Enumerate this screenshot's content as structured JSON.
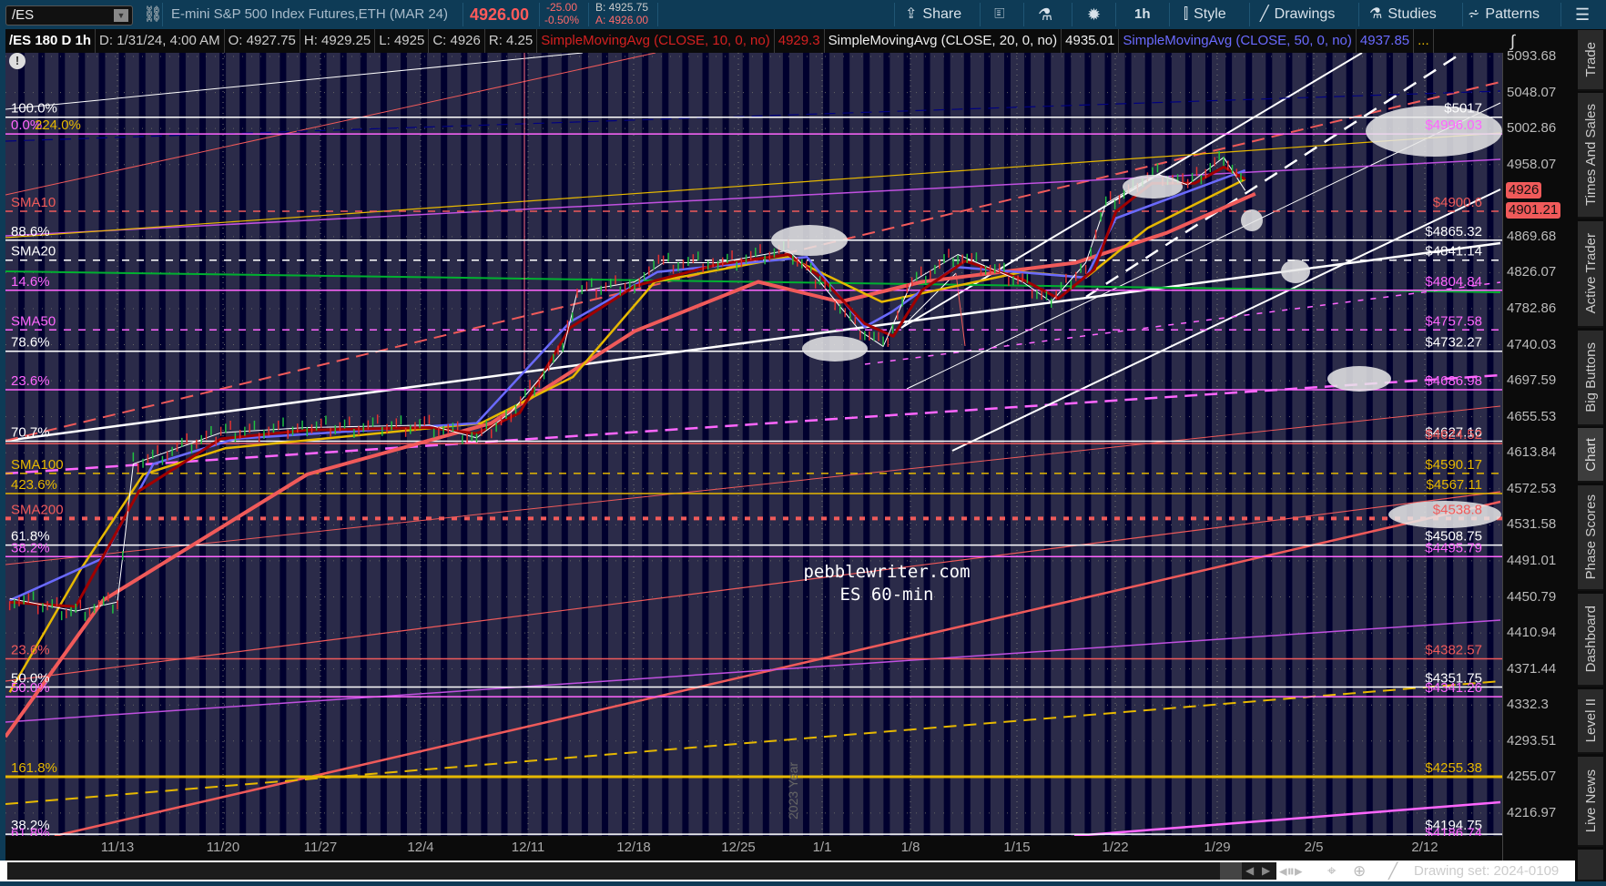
{
  "toolbar": {
    "symbol": "/ES",
    "title": "E-mini S&P 500 Index Futures,ETH (MAR 24)",
    "last_price": "4926.00",
    "change": "-25.00",
    "change_pct": "-0.50%",
    "bid": "B: 4925.75",
    "ask": "A: 4926.00",
    "buttons": {
      "share": "Share",
      "timeframe": "1h",
      "style": "Style",
      "drawings": "Drawings",
      "studies": "Studies",
      "patterns": "Patterns"
    }
  },
  "info": {
    "chart_id": "/ES 180 D 1h",
    "date": "D: 1/31/24, 4:00 AM",
    "open": "O: 4927.75",
    "high": "H: 4929.25",
    "low": "L: 4925",
    "close": "C: 4926",
    "range": "R: 4.25",
    "sma10_label": "SimpleMovingAvg (CLOSE, 10, 0, no)",
    "sma10_value": "4929.3",
    "sma20_label": "SimpleMovingAvg (CLOSE, 20, 0, no)",
    "sma20_value": "4935.01",
    "sma50_label": "SimpleMovingAvg (CLOSE, 50, 0, no)",
    "sma50_value": "4937.85",
    "more": "..."
  },
  "colors": {
    "bg": "#2b2b49",
    "stripe": "#00002e",
    "red": "#f05a5a",
    "magenta": "#ff66ff",
    "yellow": "#e6b800",
    "white": "#ffffff",
    "green": "#00b030",
    "blue": "#6a6aff",
    "darkred": "#a00000"
  },
  "price_axis": {
    "ticks": [
      "5093.68",
      "5048.07",
      "5002.86",
      "4958.07",
      "4869.68",
      "4826.07",
      "4782.86",
      "4740.03",
      "4697.59",
      "4655.53",
      "4613.84",
      "4572.53",
      "4531.58",
      "4491.01",
      "4450.79",
      "4410.94",
      "4371.44",
      "4332.3",
      "4293.51",
      "4255.07",
      "4216.97"
    ],
    "last_badge": "4926",
    "level_badge": "4901.21"
  },
  "date_axis": {
    "labels": [
      "11/13",
      "11/20",
      "11/27",
      "12/4",
      "12/11",
      "12/18",
      "12/25",
      "1/1",
      "1/8",
      "1/15",
      "1/22",
      "1/29",
      "2/5",
      "2/12"
    ],
    "year_marker": "2023 Year"
  },
  "watermark": {
    "line1": "pebblewriter.com",
    "line2": "ES 60-min"
  },
  "levels": [
    {
      "price": 5017,
      "right": "$5017",
      "left": "100.0%",
      "color": "#ffffff",
      "style": "solid"
    },
    {
      "price": 4996.03,
      "right": "$4996.03",
      "left": "0.0%",
      "left2": "224.0%",
      "color": "#ff66ff",
      "style": "solid"
    },
    {
      "price": 4900.6,
      "right": "$4900.6",
      "left": "SMA10",
      "color": "#f05a5a",
      "style": "dash"
    },
    {
      "price": 4865.32,
      "right": "$4865.32",
      "left": "88.6%",
      "color": "#ffffff",
      "style": "solid"
    },
    {
      "price": 4841.14,
      "right": "$4841.14",
      "left": "SMA20",
      "color": "#ffffff",
      "style": "dash"
    },
    {
      "price": 4804.84,
      "right": "$4804.84",
      "left": "14.6%",
      "color": "#ff66ff",
      "style": "solid"
    },
    {
      "price": 4757.58,
      "right": "$4757.58",
      "left": "SMA50",
      "color": "#ff66ff",
      "style": "dash"
    },
    {
      "price": 4732.27,
      "right": "$4732.27",
      "left": "78.6%",
      "color": "#ffffff",
      "style": "solid"
    },
    {
      "price": 4686.98,
      "right": "$4686.98",
      "left": "23.6%",
      "color": "#ff66ff",
      "style": "solid"
    },
    {
      "price": 4627.16,
      "right": "$4627.16",
      "left": "70.7%",
      "color": "#ffffff",
      "style": "solid"
    },
    {
      "price": 4624.52,
      "right": "$4624.52",
      "left": "",
      "color": "#f05a5a",
      "style": "solid"
    },
    {
      "price": 4590.17,
      "right": "$4590.17",
      "left": "SMA100",
      "color": "#e6b800",
      "style": "dash"
    },
    {
      "price": 4567.11,
      "right": "$4567.11",
      "left": "423.6%",
      "color": "#e6b800",
      "style": "solid"
    },
    {
      "price": 4538.8,
      "right": "$4538.8",
      "left": "SMA200",
      "color": "#f05a5a",
      "style": "dot"
    },
    {
      "price": 4508.75,
      "right": "$4508.75",
      "left": "61.8%",
      "color": "#ffffff",
      "style": "solid"
    },
    {
      "price": 4495.79,
      "right": "$4495.79",
      "left": "38.2%",
      "color": "#ff66ff",
      "style": "solid"
    },
    {
      "price": 4382.57,
      "right": "$4382.57",
      "left": "23.6%",
      "color": "#f05a5a",
      "style": "solid"
    },
    {
      "price": 4351.75,
      "right": "$4351.75",
      "left": "50.0%",
      "color": "#ffffff",
      "style": "solid"
    },
    {
      "price": 4341.26,
      "right": "$4341.26",
      "left": "50.0%",
      "color": "#ff66ff",
      "style": "solid"
    },
    {
      "price": 4255.38,
      "right": "$4255.38",
      "left": "161.8%",
      "color": "#e6b800",
      "style": "thick"
    },
    {
      "price": 4194.75,
      "right": "$4194.75",
      "left": "38.2%",
      "color": "#ffffff",
      "style": "solid"
    },
    {
      "price": 4186.74,
      "right": "$4186.74",
      "left": "61.8%",
      "color": "#ff66ff",
      "style": "solid"
    }
  ],
  "chart_data": {
    "type": "line",
    "title": "/ES 180 D 1h",
    "x_unit": "days since 11/13/2023",
    "ylim": [
      4216.97,
      5093.68
    ],
    "y_scale": "log",
    "series": [
      {
        "name": "price",
        "color": "#ffffff",
        "points": [
          [
            -7.5,
            4449
          ],
          [
            -2.9,
            4435
          ],
          [
            0,
            4445
          ],
          [
            1.1,
            4601
          ],
          [
            7.2,
            4637
          ],
          [
            13.2,
            4643
          ],
          [
            21.7,
            4646
          ],
          [
            25,
            4631
          ],
          [
            27.4,
            4661
          ],
          [
            31,
            4732
          ],
          [
            32,
            4803
          ],
          [
            36,
            4815
          ],
          [
            38,
            4838
          ],
          [
            41.8,
            4838
          ],
          [
            46.7,
            4853
          ],
          [
            48.9,
            4815
          ],
          [
            51.7,
            4756
          ],
          [
            53.3,
            4738
          ],
          [
            55.3,
            4815
          ],
          [
            58.5,
            4848
          ],
          [
            63,
            4815
          ],
          [
            65,
            4791
          ],
          [
            67.4,
            4838
          ],
          [
            68.8,
            4910
          ],
          [
            71,
            4933
          ],
          [
            72.4,
            4946
          ],
          [
            74.5,
            4933
          ],
          [
            77,
            4967
          ],
          [
            78.5,
            4926
          ]
        ]
      },
      {
        "name": "SMA10",
        "color": "#a00000",
        "points": [
          [
            -7.5,
            4445
          ],
          [
            -2.9,
            4440
          ],
          [
            1.5,
            4570
          ],
          [
            7.2,
            4630
          ],
          [
            13.2,
            4640
          ],
          [
            21.7,
            4643
          ],
          [
            25,
            4636
          ],
          [
            28,
            4660
          ],
          [
            31.5,
            4760
          ],
          [
            36,
            4810
          ],
          [
            41.8,
            4836
          ],
          [
            46.7,
            4848
          ],
          [
            49,
            4820
          ],
          [
            52,
            4765
          ],
          [
            54,
            4750
          ],
          [
            56,
            4805
          ],
          [
            59,
            4840
          ],
          [
            63,
            4818
          ],
          [
            65.5,
            4795
          ],
          [
            68,
            4830
          ],
          [
            69.5,
            4900
          ],
          [
            72,
            4935
          ],
          [
            75,
            4935
          ],
          [
            77,
            4955
          ],
          [
            78.5,
            4940
          ]
        ]
      },
      {
        "name": "SMA20",
        "color": "#6a6aff",
        "points": [
          [
            -7.5,
            4447
          ],
          [
            -1,
            4494
          ],
          [
            2.5,
            4601
          ],
          [
            8.2,
            4630
          ],
          [
            25,
            4648
          ],
          [
            31.5,
            4767
          ],
          [
            37.6,
            4827
          ],
          [
            48,
            4845
          ],
          [
            52,
            4761
          ],
          [
            53.9,
            4779
          ],
          [
            58.3,
            4833
          ],
          [
            67.4,
            4820
          ],
          [
            69.5,
            4892
          ],
          [
            78.5,
            4951
          ]
        ]
      },
      {
        "name": "SMA50",
        "color": "#e6b800",
        "points": [
          [
            -7.5,
            4346
          ],
          [
            -2.5,
            4483
          ],
          [
            1.8,
            4589
          ],
          [
            7.5,
            4619
          ],
          [
            25.3,
            4648
          ],
          [
            31.7,
            4702
          ],
          [
            37.4,
            4815
          ],
          [
            46.7,
            4845
          ],
          [
            53.2,
            4791
          ],
          [
            63,
            4827
          ],
          [
            67.4,
            4820
          ],
          [
            71.7,
            4880
          ],
          [
            78.5,
            4940
          ]
        ]
      },
      {
        "name": "SMA200",
        "color": "#f05a5a",
        "points": [
          [
            -7.8,
            4298
          ],
          [
            -1,
            4447
          ],
          [
            13.2,
            4589
          ],
          [
            26,
            4648
          ],
          [
            36,
            4756
          ],
          [
            44.6,
            4815
          ],
          [
            50.3,
            4791
          ],
          [
            56,
            4815
          ],
          [
            66.7,
            4838
          ],
          [
            73,
            4874
          ],
          [
            79.2,
            4922
          ]
        ]
      }
    ]
  },
  "tabs": [
    "Trade",
    "Times And Sales",
    "Active Trader",
    "Big Buttons",
    "Chart",
    "Phase Scores",
    "Dashboard",
    "Level II",
    "Live News"
  ],
  "bottom": {
    "drawing_set": "Drawing set: 2024-0109"
  }
}
